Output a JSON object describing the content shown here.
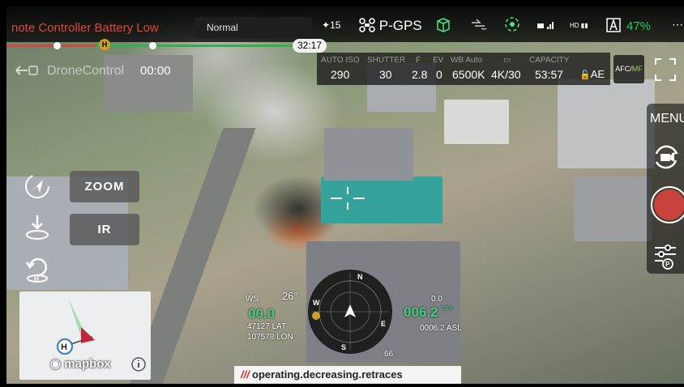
{
  "status_bar": {
    "warning": "note Controller Battery Low",
    "flight_mode": "Normal",
    "satellites": "15",
    "gps_mode": "P-GPS",
    "signal_label": "HD",
    "battery_percent": "47%"
  },
  "timeline": {
    "elapsed": "32:17",
    "home_marker": "H"
  },
  "camera": {
    "labels": [
      "AUTO ISO",
      "SHUTTER",
      "F",
      "EV",
      "WB Auto",
      "",
      "CAPACITY"
    ],
    "iso": "290",
    "shutter": "30",
    "aperture": "2.8",
    "ev": "0",
    "white_balance": "6500K",
    "video_res": "4K/30",
    "capacity": "53:57",
    "ae_label": "AE",
    "focus_label": "AFC/",
    "focus_mf": "MF"
  },
  "overlay": {
    "app_name": "DroneControl",
    "rec_time": "00:00",
    "menu_label": "MENU",
    "zoom_label": "ZOOM",
    "ir_label": "IR"
  },
  "telemetry": {
    "ws_label": "WS",
    "ws_value": "26°",
    "altitude": "00.0",
    "lat": "47127 LAT",
    "lon": "107578 LON",
    "speed": "006.2",
    "speed_unit": "m/s",
    "asl": "0006.2 ASL",
    "ds_label": "0.0",
    "heading_num": "66",
    "compass_n": "N",
    "compass_e": "E",
    "compass_s": "S",
    "compass_w": "W"
  },
  "map": {
    "home_label": "H",
    "attribution": "mapbox"
  },
  "codebar": {
    "slashes": "///",
    "text": "operating.decreasing.retraces"
  },
  "colors": {
    "warning": "#e0453c",
    "battery": "#2ecb5d",
    "telemetry_green": "#48d07e",
    "record": "#c8433b"
  }
}
